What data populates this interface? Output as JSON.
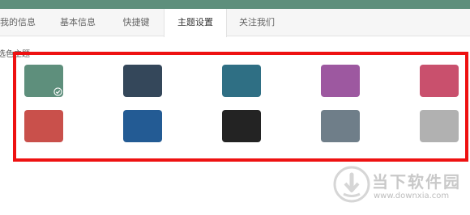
{
  "tabs": [
    {
      "label": "我的信息",
      "active": false
    },
    {
      "label": "基本信息",
      "active": false
    },
    {
      "label": "快捷键",
      "active": false
    },
    {
      "label": "主题设置",
      "active": true
    },
    {
      "label": "关注我们",
      "active": false
    }
  ],
  "section_label": "选色主题",
  "themes": [
    {
      "color": "#5e8f7c",
      "selected": true
    },
    {
      "color": "#34475a",
      "selected": false
    },
    {
      "color": "#2f6f84",
      "selected": false
    },
    {
      "color": "#9d58a0",
      "selected": false
    },
    {
      "color": "#c9506d",
      "selected": false
    },
    {
      "color": "#c9504b",
      "selected": false
    },
    {
      "color": "#235b94",
      "selected": false
    },
    {
      "color": "#232323",
      "selected": false
    },
    {
      "color": "#6f7e89",
      "selected": false
    },
    {
      "color": "#b1b1b1",
      "selected": false
    }
  ],
  "highlight_color": "#ee1111",
  "watermark": {
    "title": "当下软件园",
    "url": "www.downxia.com"
  }
}
